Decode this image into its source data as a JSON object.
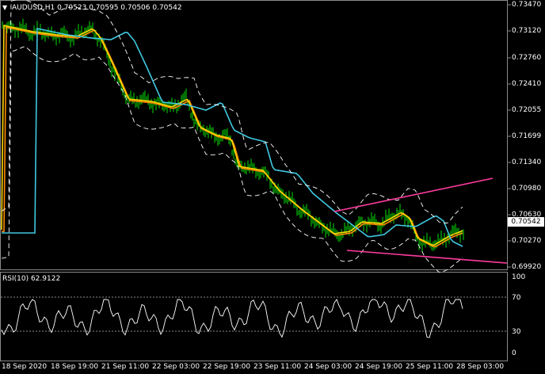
{
  "header": {
    "collapse_icon": "triangle-down-icon",
    "title": "AUDUSD,H1  0.70523 0.70595 0.70506 0.70542"
  },
  "price_axis": {
    "labels": [
      "0.73470",
      "0.73120",
      "0.72760",
      "0.72410",
      "0.72055",
      "0.71699",
      "0.71340",
      "0.70980",
      "0.70630",
      "0.70270",
      "0.69920"
    ],
    "current_price": "0.70542"
  },
  "rsi": {
    "title": "RSI(10) 62.9122",
    "axis_labels": [
      "100",
      "70",
      "30",
      "0"
    ]
  },
  "time_axis": {
    "labels": [
      "18 Sep 2020",
      "18 Sep 19:00",
      "21 Sep 11:00",
      "22 Sep 03:00",
      "22 Sep 19:00",
      "23 Sep 11:00",
      "24 Sep 03:00",
      "24 Sep 19:00",
      "25 Sep 11:00",
      "28 Sep 03:00"
    ]
  },
  "colors": {
    "background": "#000000",
    "bar": "#00e000",
    "ma_fast": "#ffd700",
    "ma_mid": "#ff8c00",
    "ma_slow": "#40c8e0",
    "bands": "#ffffff",
    "trendline": "#ff3ca0",
    "rsi_line": "#ffffff",
    "grid": "#8a8a8a"
  }
}
